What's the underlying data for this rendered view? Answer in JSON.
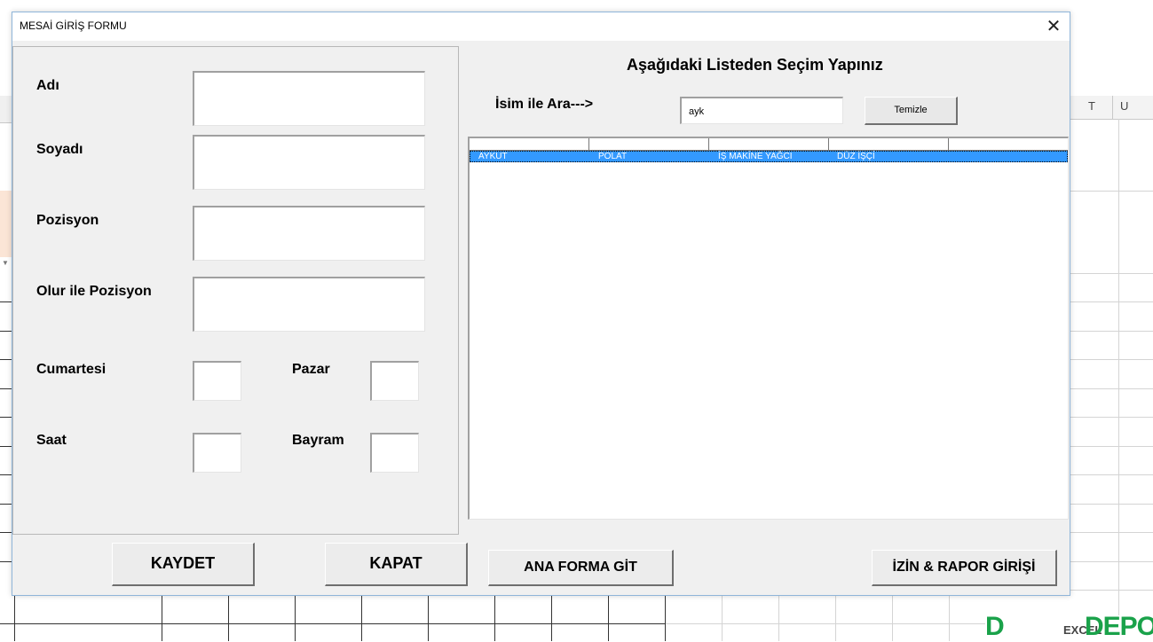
{
  "excel": {
    "column_letters": [
      "T",
      "U"
    ]
  },
  "dialog": {
    "title": "MESAİ GİRİŞ FORMU",
    "close_glyph": "✕"
  },
  "form": {
    "labels": {
      "adi": "Adı",
      "soyadi": "Soyadı",
      "pozisyon": "Pozisyon",
      "olur_ile_pozisyon": "Olur ile Pozisyon",
      "cumartesi": "Cumartesi",
      "pazar": "Pazar",
      "saat": "Saat",
      "bayram": "Bayram"
    },
    "values": {
      "adi": "",
      "soyadi": "",
      "pozisyon": "",
      "olur_ile_pozisyon": "",
      "cumartesi": "",
      "pazar": "",
      "saat": "",
      "bayram": ""
    }
  },
  "search": {
    "heading": "Aşağıdaki Listeden Seçim Yapınız",
    "label": "İsim ile Ara--->",
    "value": "ayk",
    "clear_button": "Temizle"
  },
  "list": {
    "rows": [
      {
        "col1": "AYKUT",
        "col2": "POLAT",
        "col3": "İŞ MAKİNE YAĞCI",
        "col4": "DÜZ İŞÇİ",
        "selected": true
      }
    ]
  },
  "buttons": {
    "kaydet": "KAYDET",
    "kapat": "KAPAT",
    "ana_forma_git": "ANA FORMA GİT",
    "izin_rapor": "İZİN & RAPOR GİRİŞİ"
  },
  "watermark": {
    "logo_left": "D",
    "logo_middle": "EXCEL",
    "logo_right": "DEPO"
  },
  "colors": {
    "selection": "#3399ff",
    "dialog_bg": "#f0f0f0",
    "brand_green": "#1aa24a"
  }
}
